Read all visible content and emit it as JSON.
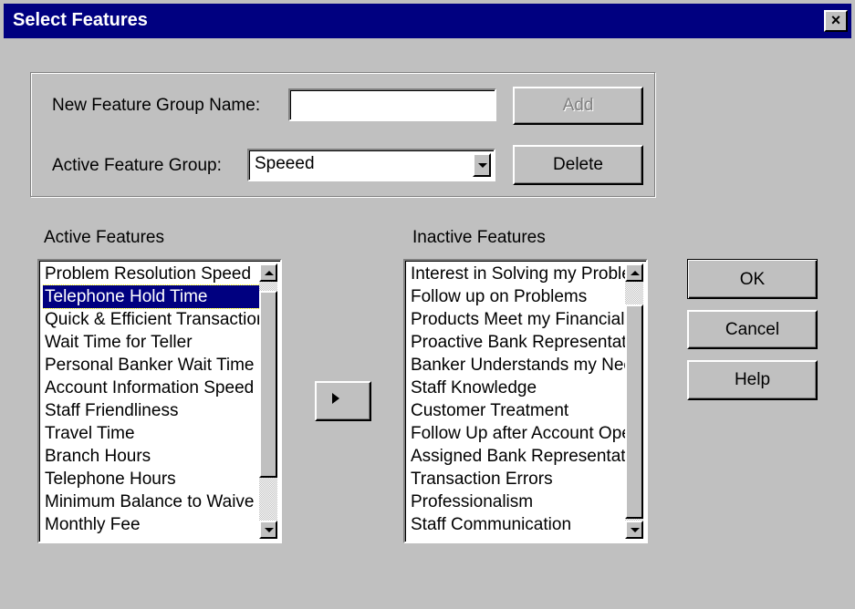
{
  "window": {
    "title": "Select Features",
    "close_label": "×"
  },
  "group": {
    "new_name_label": "New Feature Group Name:",
    "new_name_value": "",
    "add_label": "Add",
    "active_group_label": "Active Feature Group:",
    "active_group_value": "Speeed",
    "delete_label": "Delete"
  },
  "active_features": {
    "label": "Active Features",
    "items": [
      "Problem Resolution Speed",
      "Telephone Hold Time",
      "Quick & Efficient Transactions",
      "Wait Time for Teller",
      "Personal Banker Wait Time",
      "Account Information Speed",
      "Staff Friendliness",
      "Travel Time",
      "Branch Hours",
      "Telephone Hours",
      "Minimum Balance to Waive",
      "Monthly Fee"
    ],
    "selected_index": 1
  },
  "inactive_features": {
    "label": "Inactive Features",
    "items": [
      "Interest in Solving my Problems",
      "Follow up on Problems",
      "Products Meet my Financial",
      "Proactive Bank Representative",
      "Banker Understands my Needs",
      "Staff Knowledge",
      "Customer Treatment",
      "Follow Up after Account Opening",
      "Assigned Bank Representative",
      "Transaction Errors",
      "Professionalism",
      "Staff Communication"
    ]
  },
  "buttons": {
    "ok": "OK",
    "cancel": "Cancel",
    "help": "Help"
  }
}
